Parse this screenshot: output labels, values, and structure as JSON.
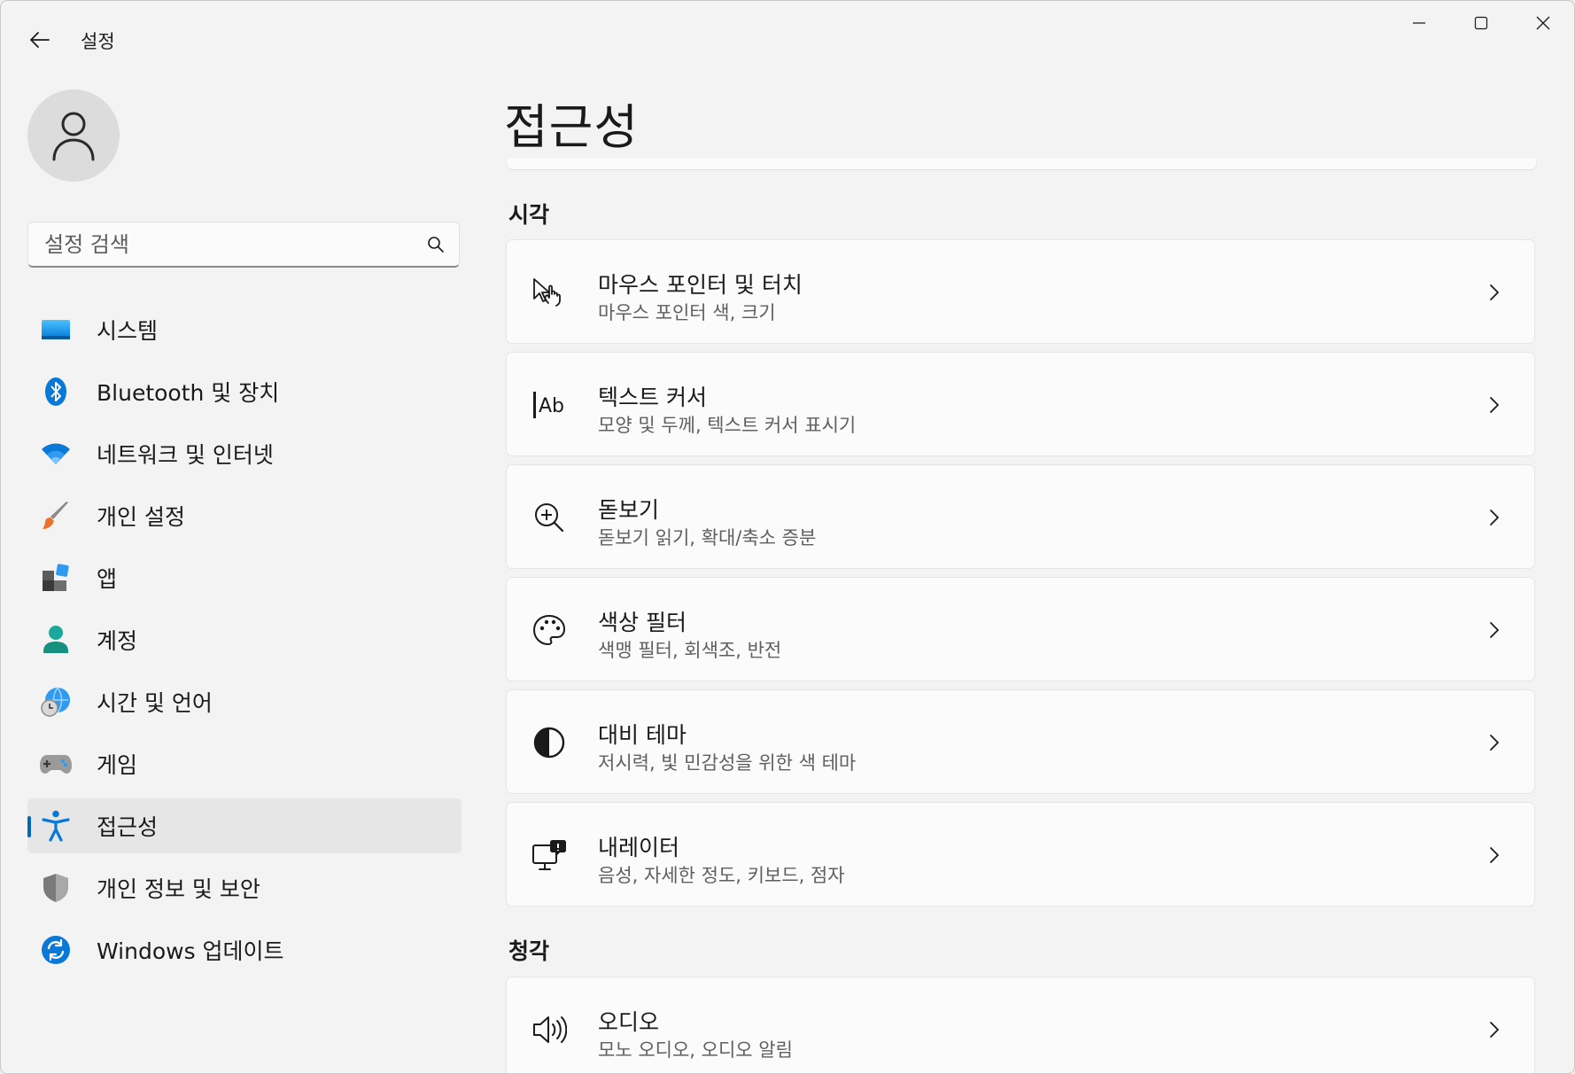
{
  "app": {
    "title": "설정"
  },
  "window_controls": {
    "minimize": "minimize-icon",
    "maximize": "maximize-icon",
    "close": "close-icon"
  },
  "search": {
    "placeholder": "설정 검색",
    "value": ""
  },
  "sidebar": {
    "items": [
      {
        "label": "시스템",
        "icon": "system-icon",
        "selected": false
      },
      {
        "label": "Bluetooth 및 장치",
        "icon": "bluetooth-icon",
        "selected": false
      },
      {
        "label": "네트워크 및 인터넷",
        "icon": "wifi-icon",
        "selected": false
      },
      {
        "label": "개인 설정",
        "icon": "brush-icon",
        "selected": false
      },
      {
        "label": "앱",
        "icon": "apps-icon",
        "selected": false
      },
      {
        "label": "계정",
        "icon": "account-icon",
        "selected": false
      },
      {
        "label": "시간 및 언어",
        "icon": "globe-clock-icon",
        "selected": false
      },
      {
        "label": "게임",
        "icon": "gamepad-icon",
        "selected": false
      },
      {
        "label": "접근성",
        "icon": "accessibility-icon",
        "selected": true
      },
      {
        "label": "개인 정보 및 보안",
        "icon": "shield-icon",
        "selected": false
      },
      {
        "label": "Windows 업데이트",
        "icon": "update-icon",
        "selected": false
      }
    ]
  },
  "main": {
    "title": "접근성",
    "sections": [
      {
        "title": "시각",
        "cards": [
          {
            "title": "마우스 포인터 및 터치",
            "subtitle": "마우스 포인터 색, 크기",
            "icon": "pointer-touch-icon"
          },
          {
            "title": "텍스트 커서",
            "subtitle": "모양 및 두께, 텍스트 커서 표시기",
            "icon": "text-cursor-icon"
          },
          {
            "title": "돋보기",
            "subtitle": "돋보기 읽기, 확대/축소 증분",
            "icon": "magnifier-icon"
          },
          {
            "title": "색상 필터",
            "subtitle": "색맹 필터, 회색조, 반전",
            "icon": "palette-icon"
          },
          {
            "title": "대비 테마",
            "subtitle": "저시력, 빛 민감성을 위한 색 테마",
            "icon": "contrast-icon"
          },
          {
            "title": "내레이터",
            "subtitle": "음성, 자세한 정도, 키보드, 점자",
            "icon": "narrator-icon"
          }
        ]
      },
      {
        "title": "청각",
        "cards": [
          {
            "title": "오디오",
            "subtitle": "모노 오디오, 오디오 알림",
            "icon": "speaker-icon"
          }
        ]
      }
    ]
  },
  "colors": {
    "accent": "#0067c0",
    "selected_bg": "#e6e6e6",
    "window_bg": "#f3f3f3",
    "card_bg": "#fbfbfb"
  }
}
